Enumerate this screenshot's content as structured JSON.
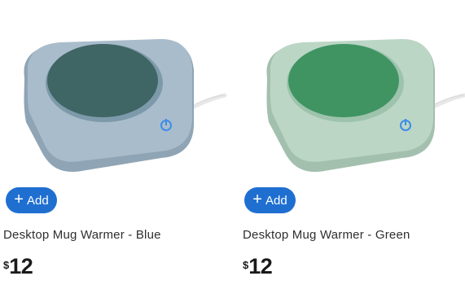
{
  "products": [
    {
      "title": "Desktop Mug Warmer - Blue",
      "add_label": "Add",
      "currency": "$",
      "price": "12",
      "color_name": "Blue",
      "colors": {
        "base": "#a9bccb",
        "base_shadow": "#8fa4b4",
        "plate": "#3f6565",
        "plate_rim": "#7d9aaa"
      }
    },
    {
      "title": "Desktop Mug Warmer - Green",
      "add_label": "Add",
      "currency": "$",
      "price": "12",
      "color_name": "Green",
      "colors": {
        "base": "#bcd6c6",
        "base_shadow": "#a3c0ae",
        "plate": "#3f9462",
        "plate_rim": "#9dc3ad"
      }
    }
  ],
  "theme": {
    "add_button": "#1f6fd1",
    "power_icon": "#3d8de8"
  }
}
